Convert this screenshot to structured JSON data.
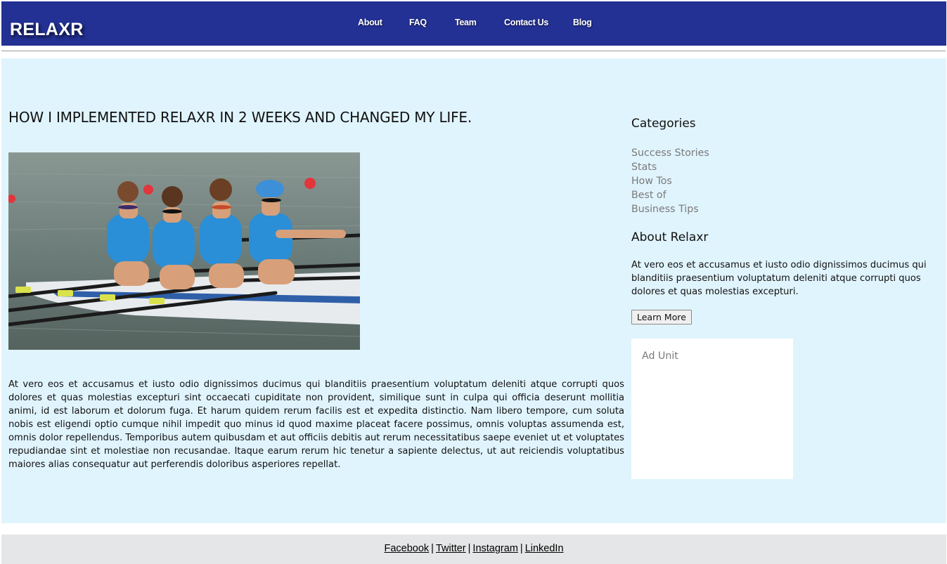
{
  "header": {
    "logo": "RELAXR",
    "nav": [
      "About",
      "FAQ",
      "Team",
      "Contact Us",
      "Blog"
    ]
  },
  "post": {
    "title": "HOW I IMPLEMENTED RELAXR IN 2 WEEKS AND CHANGED MY LIFE.",
    "image_alt": "four rowers in blue suits rowing a boat",
    "body": "At vero eos et accusamus et iusto odio dignissimos ducimus qui blanditiis praesentium voluptatum deleniti atque corrupti quos dolores et quas molestias excepturi sint occaecati cupiditate non provident, similique sunt in culpa qui officia deserunt mollitia animi, id est laborum et dolorum fuga. Et harum quidem rerum facilis est et expedita distinctio. Nam libero tempore, cum soluta nobis est eligendi optio cumque nihil impedit quo minus id quod maxime placeat facere possimus, omnis voluptas assumenda est, omnis dolor repellendus. Temporibus autem quibusdam et aut officiis debitis aut rerum necessitatibus saepe eveniet ut et voluptates repudiandae sint et molestiae non recusandae. Itaque earum rerum hic tenetur a sapiente delectus, ut aut reiciendis voluptatibus maiores alias consequatur aut perferendis doloribus asperiores repellat."
  },
  "sidebar": {
    "categories_heading": "Categories",
    "categories": [
      "Success Stories",
      "Stats",
      "How Tos",
      "Best of",
      "Business Tips"
    ],
    "about_heading": "About Relaxr",
    "about_text": "At vero eos et accusamus et iusto odio dignissimos ducimus qui blanditiis praesentium voluptatum deleniti atque corrupti quos dolores et quas molestias excepturi.",
    "learn_more": "Learn More",
    "ad_label": "Ad Unit"
  },
  "footer": {
    "links": [
      "Facebook",
      "Twitter",
      "Instagram",
      "LinkedIn"
    ],
    "separator": "|"
  },
  "colors": {
    "header_bg": "#233195",
    "content_bg": "#e0f4fd",
    "footer_bg": "#e5e6e7",
    "category_link": "#7a7a7a"
  }
}
